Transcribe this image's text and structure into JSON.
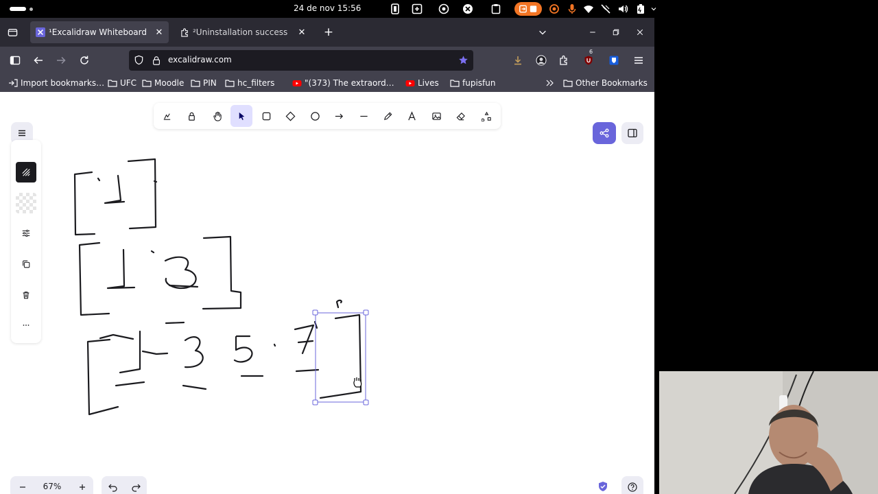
{
  "topbar": {
    "clock": "24 de nov 15:56"
  },
  "browser": {
    "tabs": [
      {
        "label": "¹Excalidraw Whiteboard",
        "active": true
      },
      {
        "label": "²Uninstallation success",
        "active": false
      }
    ],
    "url": "excalidraw.com",
    "extension_badge": "6",
    "bookmarks": [
      {
        "label": "Import bookmarks…",
        "icon": "import-icon"
      },
      {
        "label": "UFC",
        "icon": "folder-icon"
      },
      {
        "label": "Moodle",
        "icon": "folder-icon"
      },
      {
        "label": "PIN",
        "icon": "folder-icon"
      },
      {
        "label": "hc_filters",
        "icon": "folder-icon"
      },
      {
        "label": "\"(373) The extraord…",
        "icon": "youtube-icon"
      },
      {
        "label": "Lives",
        "icon": "youtube-icon"
      },
      {
        "label": "fupisfun",
        "icon": "folder-icon"
      }
    ],
    "other_bookmarks": "Other Bookmarks"
  },
  "excalidraw": {
    "zoom": "67%",
    "selected_tool": "selection",
    "tools": [
      "lock",
      "hand",
      "selection",
      "rectangle",
      "diamond",
      "ellipse",
      "arrow",
      "line",
      "draw",
      "text",
      "image",
      "eraser",
      "more-tools"
    ],
    "colors": {
      "accent": "#6965db",
      "selected_tool_bg": "#e0dfff",
      "selection_box": "#6965db"
    }
  }
}
